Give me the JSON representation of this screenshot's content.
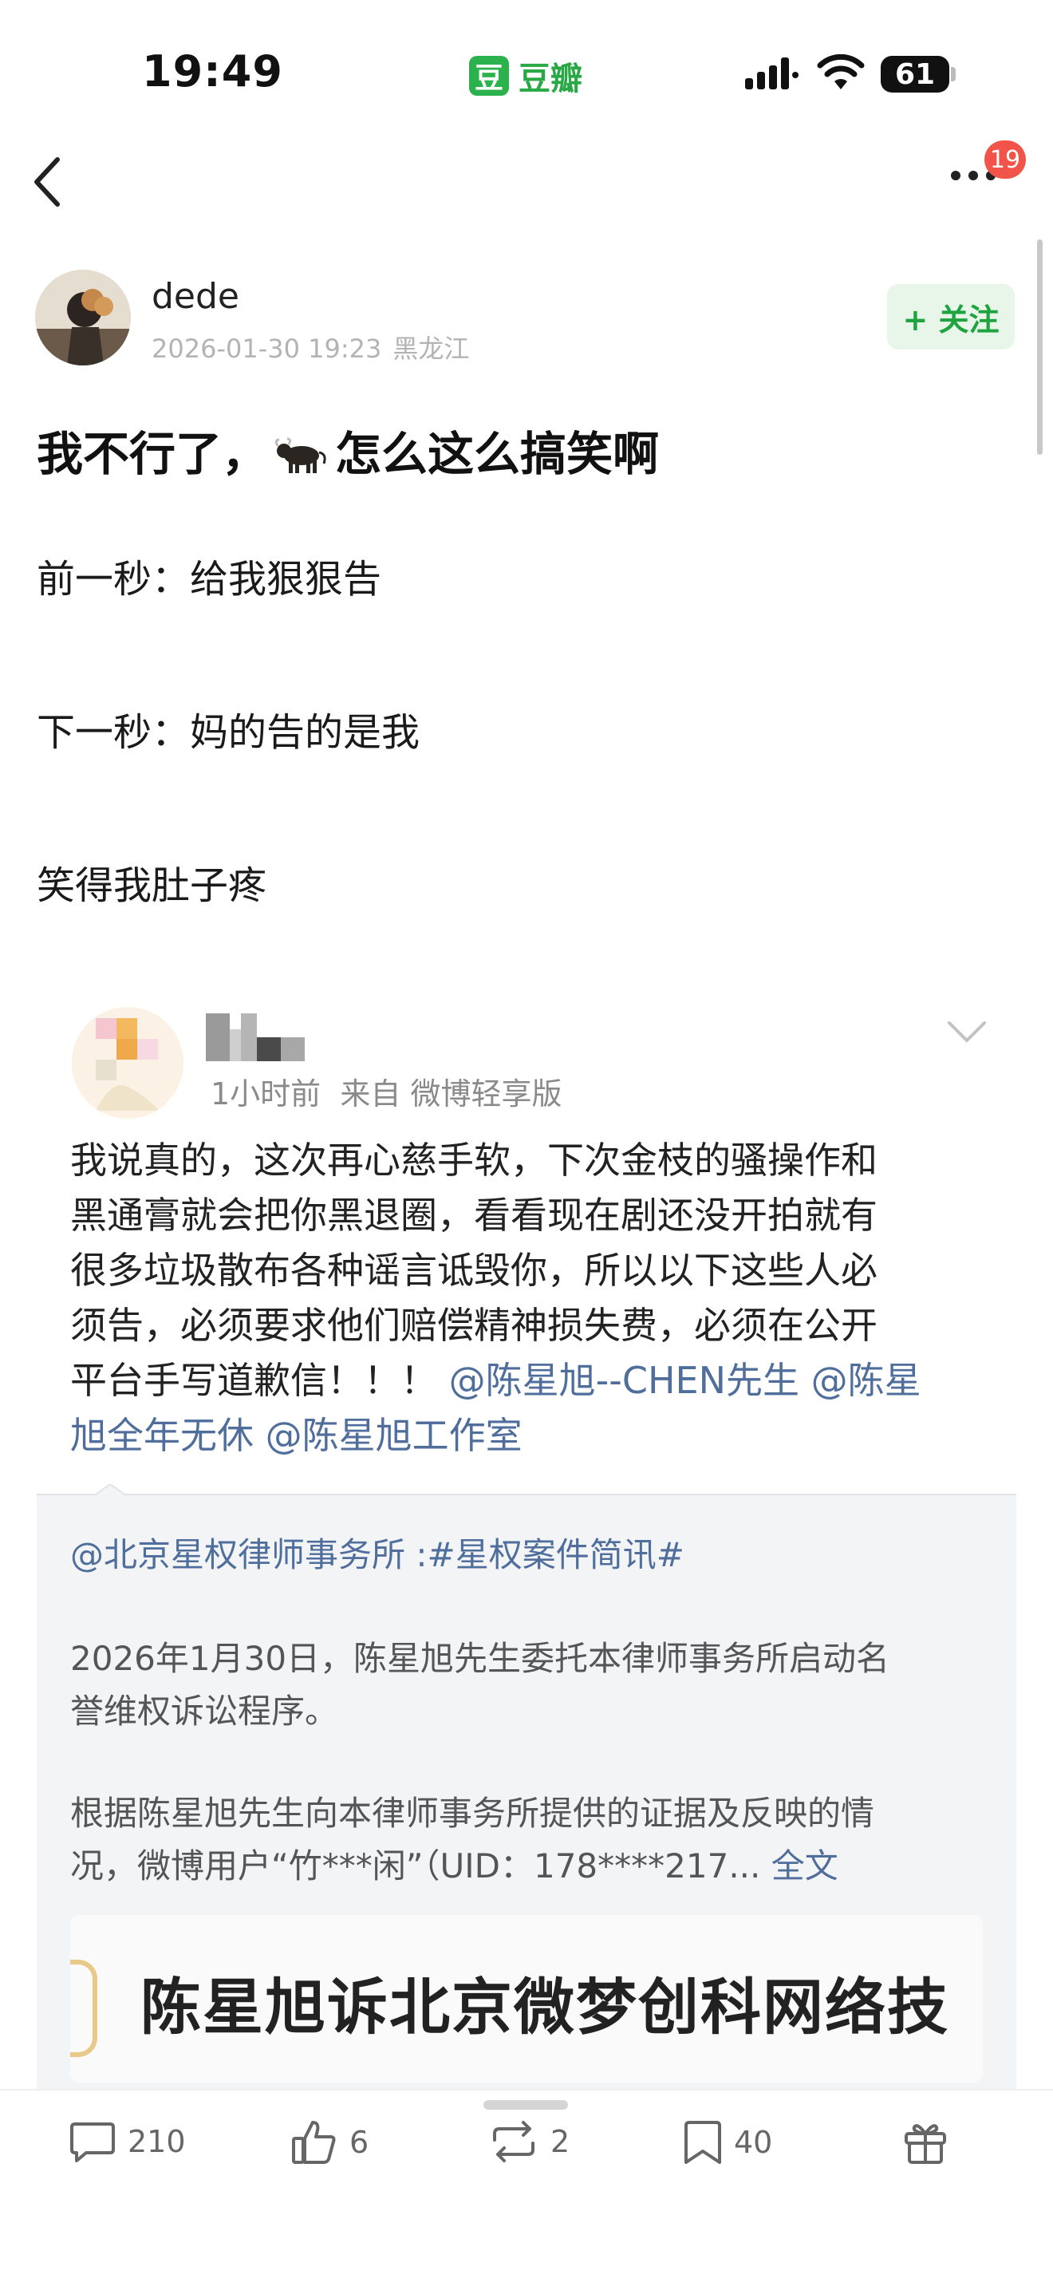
{
  "status_bar": {
    "time": "19:49",
    "app_name": "豆瓣",
    "app_logo": "豆",
    "battery": "61"
  },
  "nav": {
    "badge_count": "19"
  },
  "author": {
    "name": "dede",
    "datetime": "2026-01-30 19:23",
    "location": "黑龙江",
    "follow_label": "+ 关注"
  },
  "post": {
    "title_before": "我不行了，",
    "title_emoji": "bull-icon",
    "title_after": "怎么这么搞笑啊",
    "lines": [
      "前一秒：给我狠狠告",
      "下一秒：妈的告的是我",
      "笑得我肚子疼"
    ]
  },
  "repost": {
    "time": "1小时前",
    "source": "来自 微博轻享版",
    "text_lines": [
      "我说真的，这次再心慈手软，下次金枝的骚操作和",
      "黑通膏就会把你黑退圈，看看现在剧还没开拍就有",
      "很多垃圾散布各种谣言诋毁你，所以以下这些人必",
      "须告，必须要求他们赔偿精神损失费，必须在公开"
    ],
    "text_line5_plain": "平台手写道歉信！！！",
    "mention_1": "@陈星旭--CHEN先生",
    "mention_2a": "@陈星",
    "mention_2b": "旭全年无休",
    "mention_3": "@陈星旭工作室",
    "quote": {
      "header": "@北京星权律师事务所 :#星权案件简讯#",
      "para1_line1": "2026年1月30日，陈星旭先生委托本律师事务所启动名",
      "para1_line2": "誉维权诉讼程序。",
      "para2_line1": "根据陈星旭先生向本律师事务所提供的证据及反映的情",
      "para2_line2": "况，微博用户“竹***闲”（UID：178****217...",
      "full_text": "全文",
      "image_caption": "陈星旭诉北京微梦创科网络技"
    }
  },
  "actions": {
    "comments": "210",
    "likes": "6",
    "reposts": "2",
    "collects": "40"
  }
}
